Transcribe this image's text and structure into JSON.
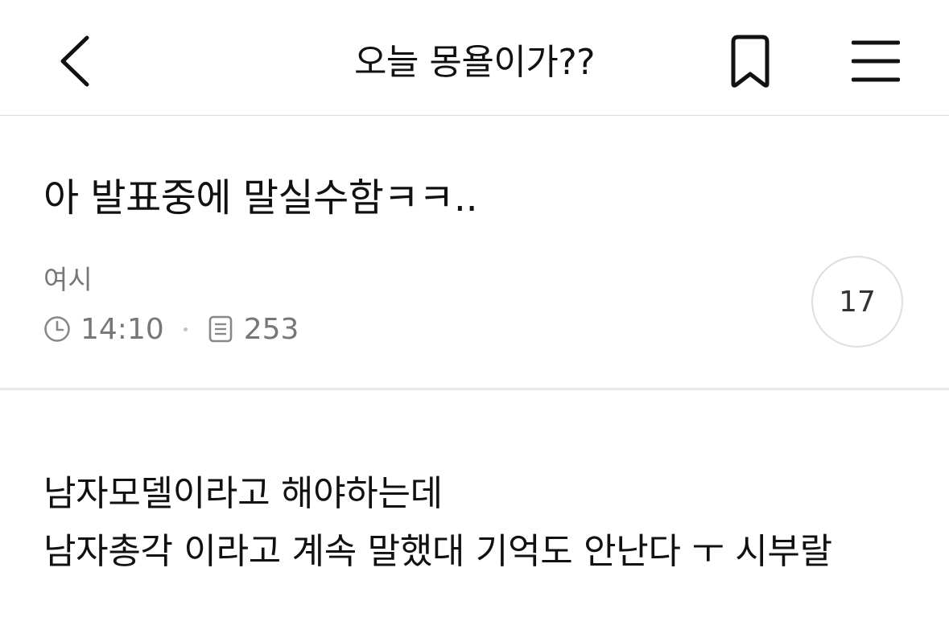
{
  "header": {
    "back_icon": "chevron-left-icon",
    "title": "오늘 몽욜이가??",
    "bookmark_icon": "bookmark-icon",
    "menu_icon": "hamburger-menu-icon"
  },
  "post": {
    "title": "아 발표중에 말실수함ㅋㅋ..",
    "author": "여시",
    "time": "14:10",
    "time_icon": "clock-icon",
    "views": "253",
    "views_icon": "document-icon",
    "comment_count": "17"
  },
  "content": {
    "lines": [
      "남자모델이라고 해야하는데",
      "남자총각 이라고 계속 말했대 기억도 안난다 ㅜ 시부랄"
    ]
  },
  "colors": {
    "text_primary": "#111111",
    "text_secondary": "#777777",
    "divider": "#e8e8e8",
    "badge_border": "#dedede"
  }
}
